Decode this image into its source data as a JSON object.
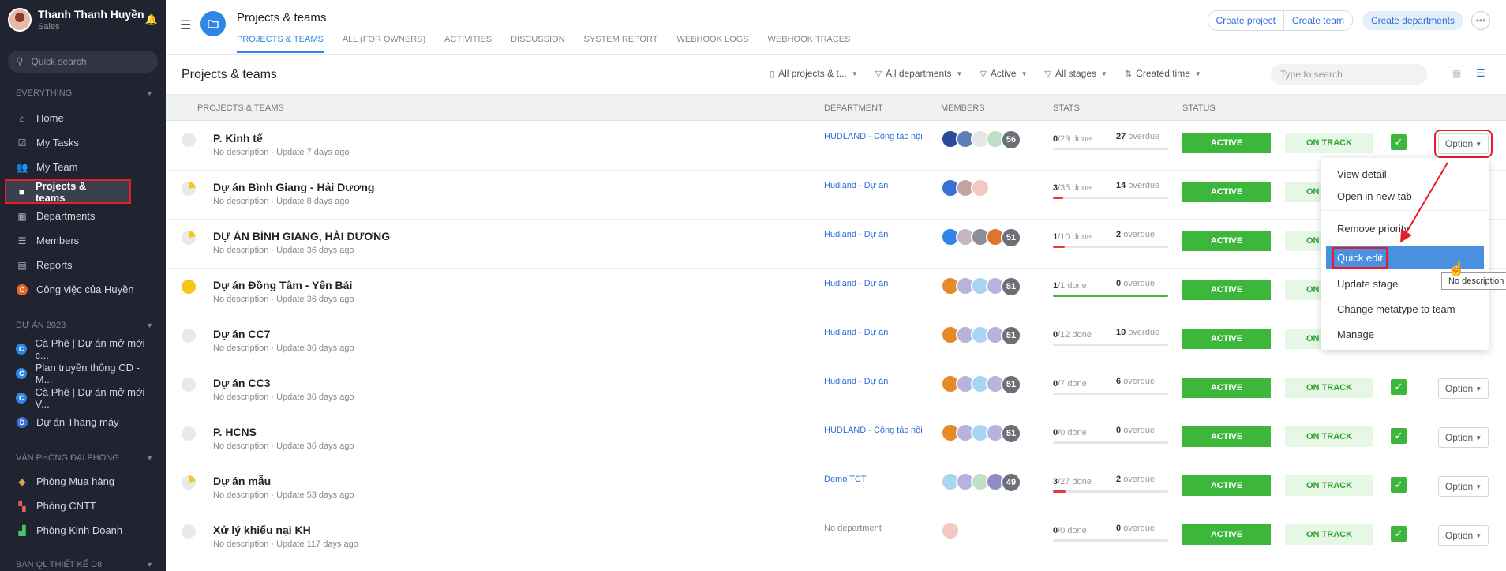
{
  "user": {
    "name": "Thanh Thanh Huyền",
    "role": "Sales"
  },
  "sidebar": {
    "search_placeholder": "Quick search",
    "section_everything": "EVERYTHING",
    "main_items": [
      {
        "label": "Home",
        "icon": "home-icon"
      },
      {
        "label": "My Tasks",
        "icon": "tasks-icon"
      },
      {
        "label": "My Team",
        "icon": "team-icon"
      },
      {
        "label": "Projects & teams",
        "icon": "folder-icon"
      },
      {
        "label": "Departments",
        "icon": "departments-icon"
      },
      {
        "label": "Members",
        "icon": "members-icon"
      },
      {
        "label": "Reports",
        "icon": "reports-icon"
      },
      {
        "label": "Công việc của Huyền",
        "badge": "C"
      }
    ],
    "section_duan": "DỰ ÁN 2023",
    "duan_items": [
      {
        "label": "Cà Phê | Dự án mở mới c...",
        "badge": "C"
      },
      {
        "label": "Plan truyền thông CD - M...",
        "badge": "C"
      },
      {
        "label": "Cà Phê | Dự án mở mới V...",
        "badge": "C"
      },
      {
        "label": "Dự án Thang máy",
        "badge": "D"
      }
    ],
    "section_vanphong": "VĂN PHÒNG ĐẠI PHONG",
    "vanphong_items": [
      {
        "label": "Phòng Mua hàng"
      },
      {
        "label": "Phòng CNTT"
      },
      {
        "label": "Phòng Kinh Doanh"
      }
    ],
    "section_banql": "BAN QL THIẾT KẾ D8"
  },
  "header": {
    "title": "Projects & teams",
    "tabs": [
      "PROJECTS & TEAMS",
      "ALL (FOR OWNERS)",
      "ACTIVITIES",
      "DISCUSSION",
      "SYSTEM REPORT",
      "WEBHOOK LOGS",
      "WEBHOOK TRACES"
    ],
    "create_project": "Create project",
    "create_team": "Create team",
    "create_departments": "Create departments"
  },
  "toolbar": {
    "title": "Projects & teams",
    "filters": [
      "All projects & t...",
      "All departments",
      "Active",
      "All stages",
      "Created time"
    ],
    "search_placeholder": "Type to search"
  },
  "table": {
    "headers": [
      "PROJECTS & TEAMS",
      "DEPARTMENT",
      "MEMBERS",
      "STATS",
      "STATUS"
    ],
    "done_label": "done",
    "overdue_label": "overdue",
    "status_label": "ACTIVE",
    "track_label": "ON TRACK",
    "option_label": "Option",
    "rows": [
      {
        "name": "P. Kinh tế",
        "desc": "No description · Update 7 days ago",
        "dept": "HUDLAND - Công tác nội",
        "done": "0",
        "total": "/29",
        "overdue": "27",
        "count": "56",
        "progress": 0,
        "prio": "none"
      },
      {
        "name": "Dự án Bình Giang - Hải Dương",
        "desc": "No description · Update 8 days ago",
        "dept": "Hudland - Dự án",
        "done": "3",
        "total": "/35",
        "overdue": "14",
        "count": "",
        "progress": 0.086,
        "prio": "partial"
      },
      {
        "name": "DỰ ÁN BÌNH GIANG, HẢI DƯƠNG",
        "desc": "No description · Update 36 days ago",
        "dept": "Hudland - Dự án",
        "done": "1",
        "total": "/10",
        "overdue": "2",
        "count": "51",
        "progress": 0.1,
        "prio": "partial"
      },
      {
        "name": "Dự án Đồng Tâm - Yên Bái",
        "desc": "No description · Update 36 days ago",
        "dept": "Hudland - Dự án",
        "done": "1",
        "total": "/1",
        "overdue": "0",
        "count": "51",
        "progress": 1,
        "prio": "full"
      },
      {
        "name": "Dự án CC7",
        "desc": "No description · Update 36 days ago",
        "dept": "Hudland - Dự án",
        "done": "0",
        "total": "/12",
        "overdue": "10",
        "count": "51",
        "progress": 0,
        "prio": "none"
      },
      {
        "name": "Dự án CC3",
        "desc": "No description · Update 36 days ago",
        "dept": "Hudland - Dự án",
        "done": "0",
        "total": "/7",
        "overdue": "6",
        "count": "51",
        "progress": 0,
        "prio": "none"
      },
      {
        "name": "P. HCNS",
        "desc": "No description · Update 36 days ago",
        "dept": "HUDLAND - Công tác nội",
        "done": "0",
        "total": "/0",
        "overdue": "0",
        "count": "51",
        "progress": 0,
        "prio": "none"
      },
      {
        "name": "Dự án mẫu",
        "desc": "No description · Update 53 days ago",
        "dept": "Demo TCT",
        "done": "3",
        "total": "/27",
        "overdue": "2",
        "count": "49",
        "progress": 0.11,
        "prio": "partial"
      },
      {
        "name": "Xử lý khiếu nại KH",
        "desc": "No description · Update 117 days ago",
        "dept": "No department",
        "done": "0",
        "total": "/0",
        "overdue": "0",
        "count": "",
        "progress": 0,
        "prio": "none"
      }
    ]
  },
  "menu": {
    "items": [
      "View detail",
      "Open in new tab",
      "Remove priority",
      "Quick edit",
      "Update stage",
      "Change metatype to team",
      "Manage"
    ],
    "tooltip": "No description"
  },
  "colors": {
    "accent": "#2e87e6",
    "active_green": "#3cb73c",
    "highlight_red": "#e61e2a",
    "sidebar_bg": "#1f2430"
  }
}
